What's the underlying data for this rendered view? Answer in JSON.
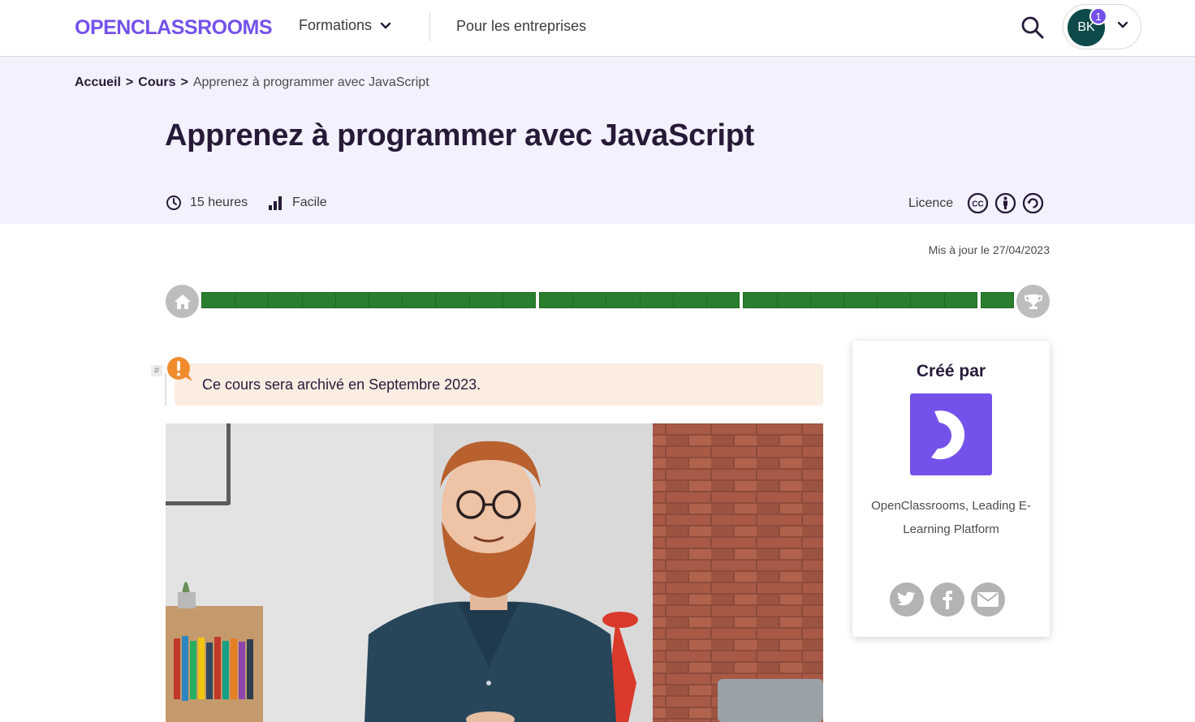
{
  "header": {
    "logo_text": "OPENCLASSROOMS",
    "nav_formations": "Formations",
    "nav_entreprises": "Pour les entreprises",
    "user_initials": "BK",
    "notification_count": "1"
  },
  "breadcrumb": {
    "home": "Accueil",
    "courses": "Cours",
    "separator": ">",
    "current": "Apprenez à programmer avec JavaScript"
  },
  "course": {
    "title": "Apprenez à programmer avec JavaScript",
    "duration": "15 heures",
    "difficulty": "Facile",
    "licence_label": "Licence",
    "updated": "Mis à jour le 27/04/2023"
  },
  "progress": {
    "completed_fraction": 1.0,
    "parts": [
      10,
      6,
      7,
      1
    ]
  },
  "alert": {
    "hash": "#",
    "text": "Ce cours sera archivé en Septembre 2023."
  },
  "creator": {
    "title": "Créé par",
    "name": "OpenClassrooms, Leading E-Learning Platform"
  },
  "colors": {
    "brand": "#7451eb",
    "progress_done": "#2a7f2e",
    "hero_bg": "#f3f1fd",
    "alert_bg": "#fcede2",
    "alert_icon": "#f08c2e"
  }
}
